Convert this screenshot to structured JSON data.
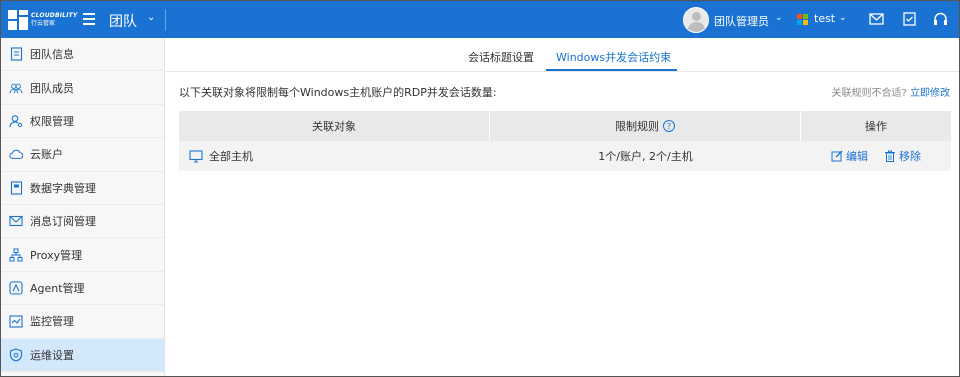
{
  "brand": {
    "name_en": "CLOUDBILITY",
    "name_cn": "行云管家"
  },
  "header": {
    "team_title": "团队",
    "user_name": "团队管理员",
    "tenant_name": "test",
    "icons": [
      "mail-icon",
      "checklist-icon",
      "headset-icon"
    ]
  },
  "sidebar": {
    "items": [
      {
        "label": "团队信息",
        "icon": "document-icon"
      },
      {
        "label": "团队成员",
        "icon": "users-icon"
      },
      {
        "label": "权限管理",
        "icon": "user-key-icon"
      },
      {
        "label": "云账户",
        "icon": "cloud-icon"
      },
      {
        "label": "数据字典管理",
        "icon": "dictionary-icon"
      },
      {
        "label": "消息订阅管理",
        "icon": "mail-icon"
      },
      {
        "label": "Proxy管理",
        "icon": "network-icon"
      },
      {
        "label": "Agent管理",
        "icon": "agent-icon"
      },
      {
        "label": "监控管理",
        "icon": "monitor-chart-icon"
      },
      {
        "label": "运维设置",
        "icon": "shield-gear-icon",
        "active": true
      }
    ]
  },
  "tabs": [
    {
      "label": "会话标题设置",
      "active": false
    },
    {
      "label": "Windows并发会话约束",
      "active": true
    }
  ],
  "main": {
    "description": "以下关联对象将限制每个Windows主机账户的RDP并发会话数量:",
    "hint_text": "关联规则不合适?",
    "hint_link": "立即修改"
  },
  "table": {
    "headers": {
      "target": "关联对象",
      "rule": "限制规则",
      "actions": "操作"
    },
    "rows": [
      {
        "target": "全部主机",
        "rule": "1个/账户, 2个/主机",
        "edit": "编辑",
        "remove": "移除"
      }
    ]
  },
  "colors": {
    "primary": "#1a73d2",
    "active_bg": "#d4e8fb",
    "sidebar_bg": "#f7f7f7"
  }
}
